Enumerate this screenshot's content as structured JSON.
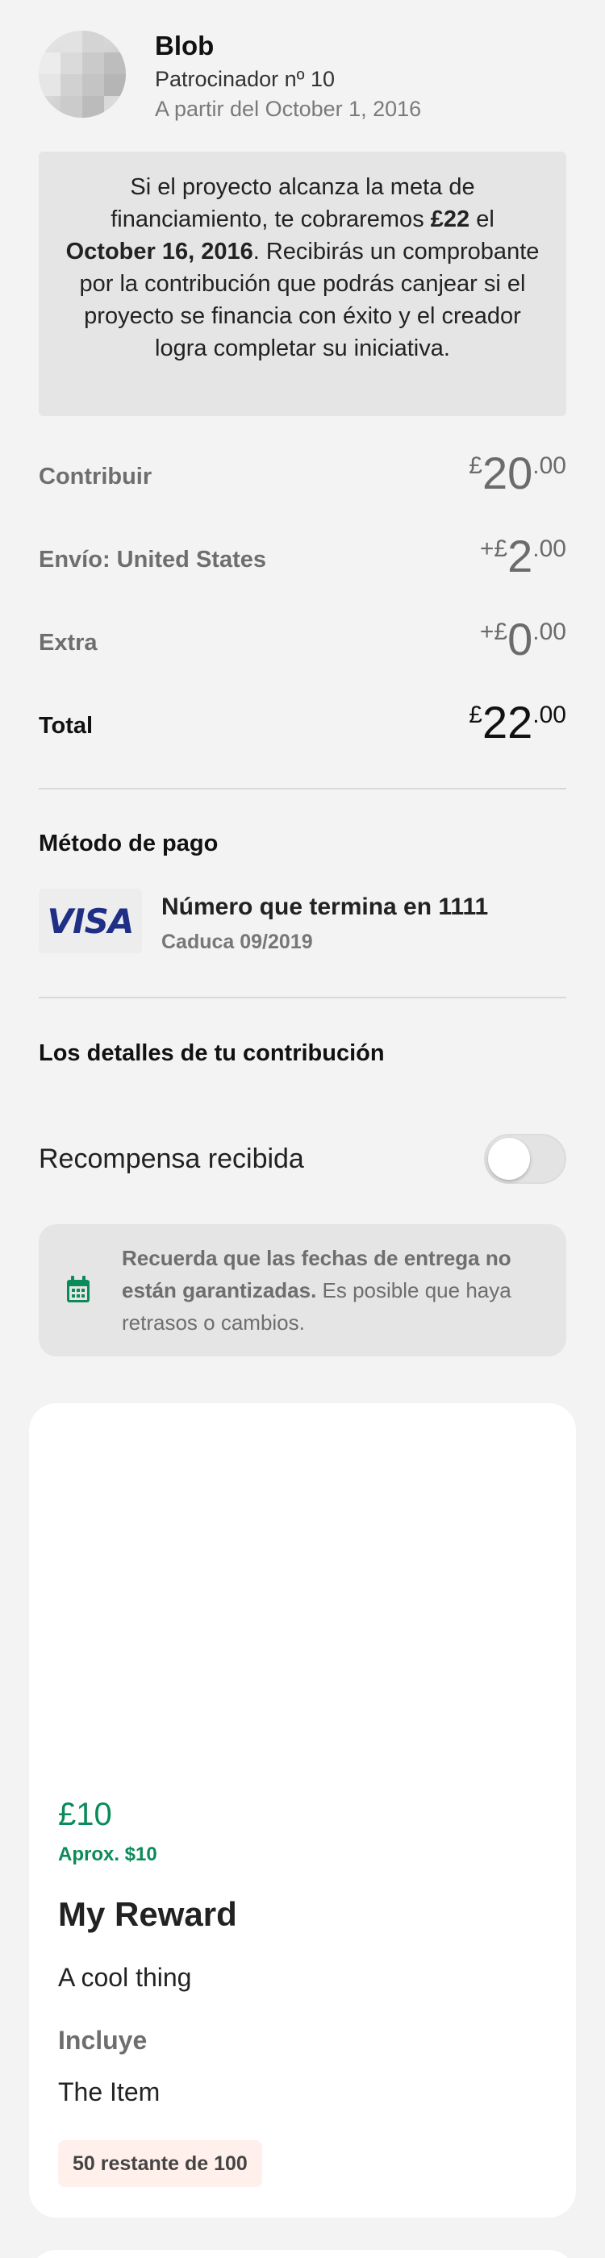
{
  "header": {
    "name": "Blob",
    "backer_label": "Patrocinador nº 10",
    "since_label": "A partir del October 1, 2016"
  },
  "notice": {
    "part1": "Si el proyecto alcanza la meta de financiamiento, te cobraremos ",
    "amount": "£22",
    "part2": " el ",
    "date": "October 16, 2016",
    "part3": ". Recibirás un comprobante por la contribución que podrás canjear si el proyecto se financia con éxito y el creador logra completar su iniciativa."
  },
  "amounts": {
    "pledge": {
      "label": "Contribuir",
      "prefix": "£",
      "int": "20",
      "dec": ".00"
    },
    "shipping": {
      "label": "Envío: United States",
      "prefix": "+£",
      "int": "2",
      "dec": ".00"
    },
    "extra": {
      "label": "Extra",
      "prefix": "+£",
      "int": "0",
      "dec": ".00"
    },
    "total": {
      "label": "Total",
      "prefix": "£",
      "int": "22",
      "dec": ".00"
    }
  },
  "payment": {
    "title": "Método de pago",
    "brand": "VISA",
    "card_number": "Número que termina en 1111",
    "expires": "Caduca 09/2019"
  },
  "details": {
    "title": "Los detalles de tu contribución",
    "reward_received_label": "Recompensa recibida",
    "reward_received": false
  },
  "delivery": {
    "bold": "Recuerda que las fechas de entrega no están garantizadas.",
    "rest": " Es posible que haya retrasos o cambios."
  },
  "reward": {
    "price": "£10",
    "approx": "Aprox. $10",
    "title": "My Reward",
    "description": "A cool thing",
    "includes_label": "Incluye",
    "item": "The Item",
    "remaining": "50 restante de 100"
  },
  "colors": {
    "accent_green": "#0b8a5a",
    "visa_blue": "#1f2f86",
    "badge_bg": "#fff0ec"
  }
}
